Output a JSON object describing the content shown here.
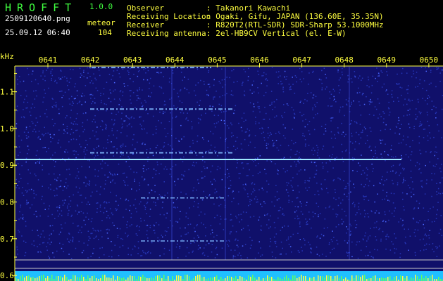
{
  "app": {
    "name": "HROFFT",
    "version": "1.0.0"
  },
  "file": {
    "name": "2509120640.png",
    "datetime": "25.09.12 06:40"
  },
  "detection": {
    "label": "meteor",
    "count": "104"
  },
  "info": {
    "observer_label": "Observer",
    "observer_value": ": Takanori Kawachi",
    "location_label": "Receiving Location",
    "location_value": ": Ogaki, Gifu, JAPAN (136.60E, 35.35N)",
    "receiver_label": "Receiver",
    "receiver_value": ": R820T2(RTL-SDR) SDR-Sharp 53.1000MHz",
    "antenna_label": "Receiving antenna",
    "antenna_value": ": 2el-HB9CV Vertical (el. E-W)"
  },
  "spectrogram": {
    "y_unit": "kHz",
    "time_ticks": [
      "0641",
      "0642",
      "0643",
      "0644",
      "0645",
      "0646",
      "0647",
      "0648",
      "0649",
      "0650"
    ],
    "freq_ticks": [
      "1.1",
      "1.0",
      "0.9",
      "0.8",
      "0.7",
      "0.6"
    ],
    "freq_range_khz": [
      0.585,
      1.17
    ],
    "carrier_khz": 0.905,
    "colors": {
      "background": "#10106a",
      "noise": "#2a3ad0",
      "signal": "#7fd8ff",
      "axis": "#ffff40",
      "bottom_bar": "#20c0ff"
    }
  }
}
